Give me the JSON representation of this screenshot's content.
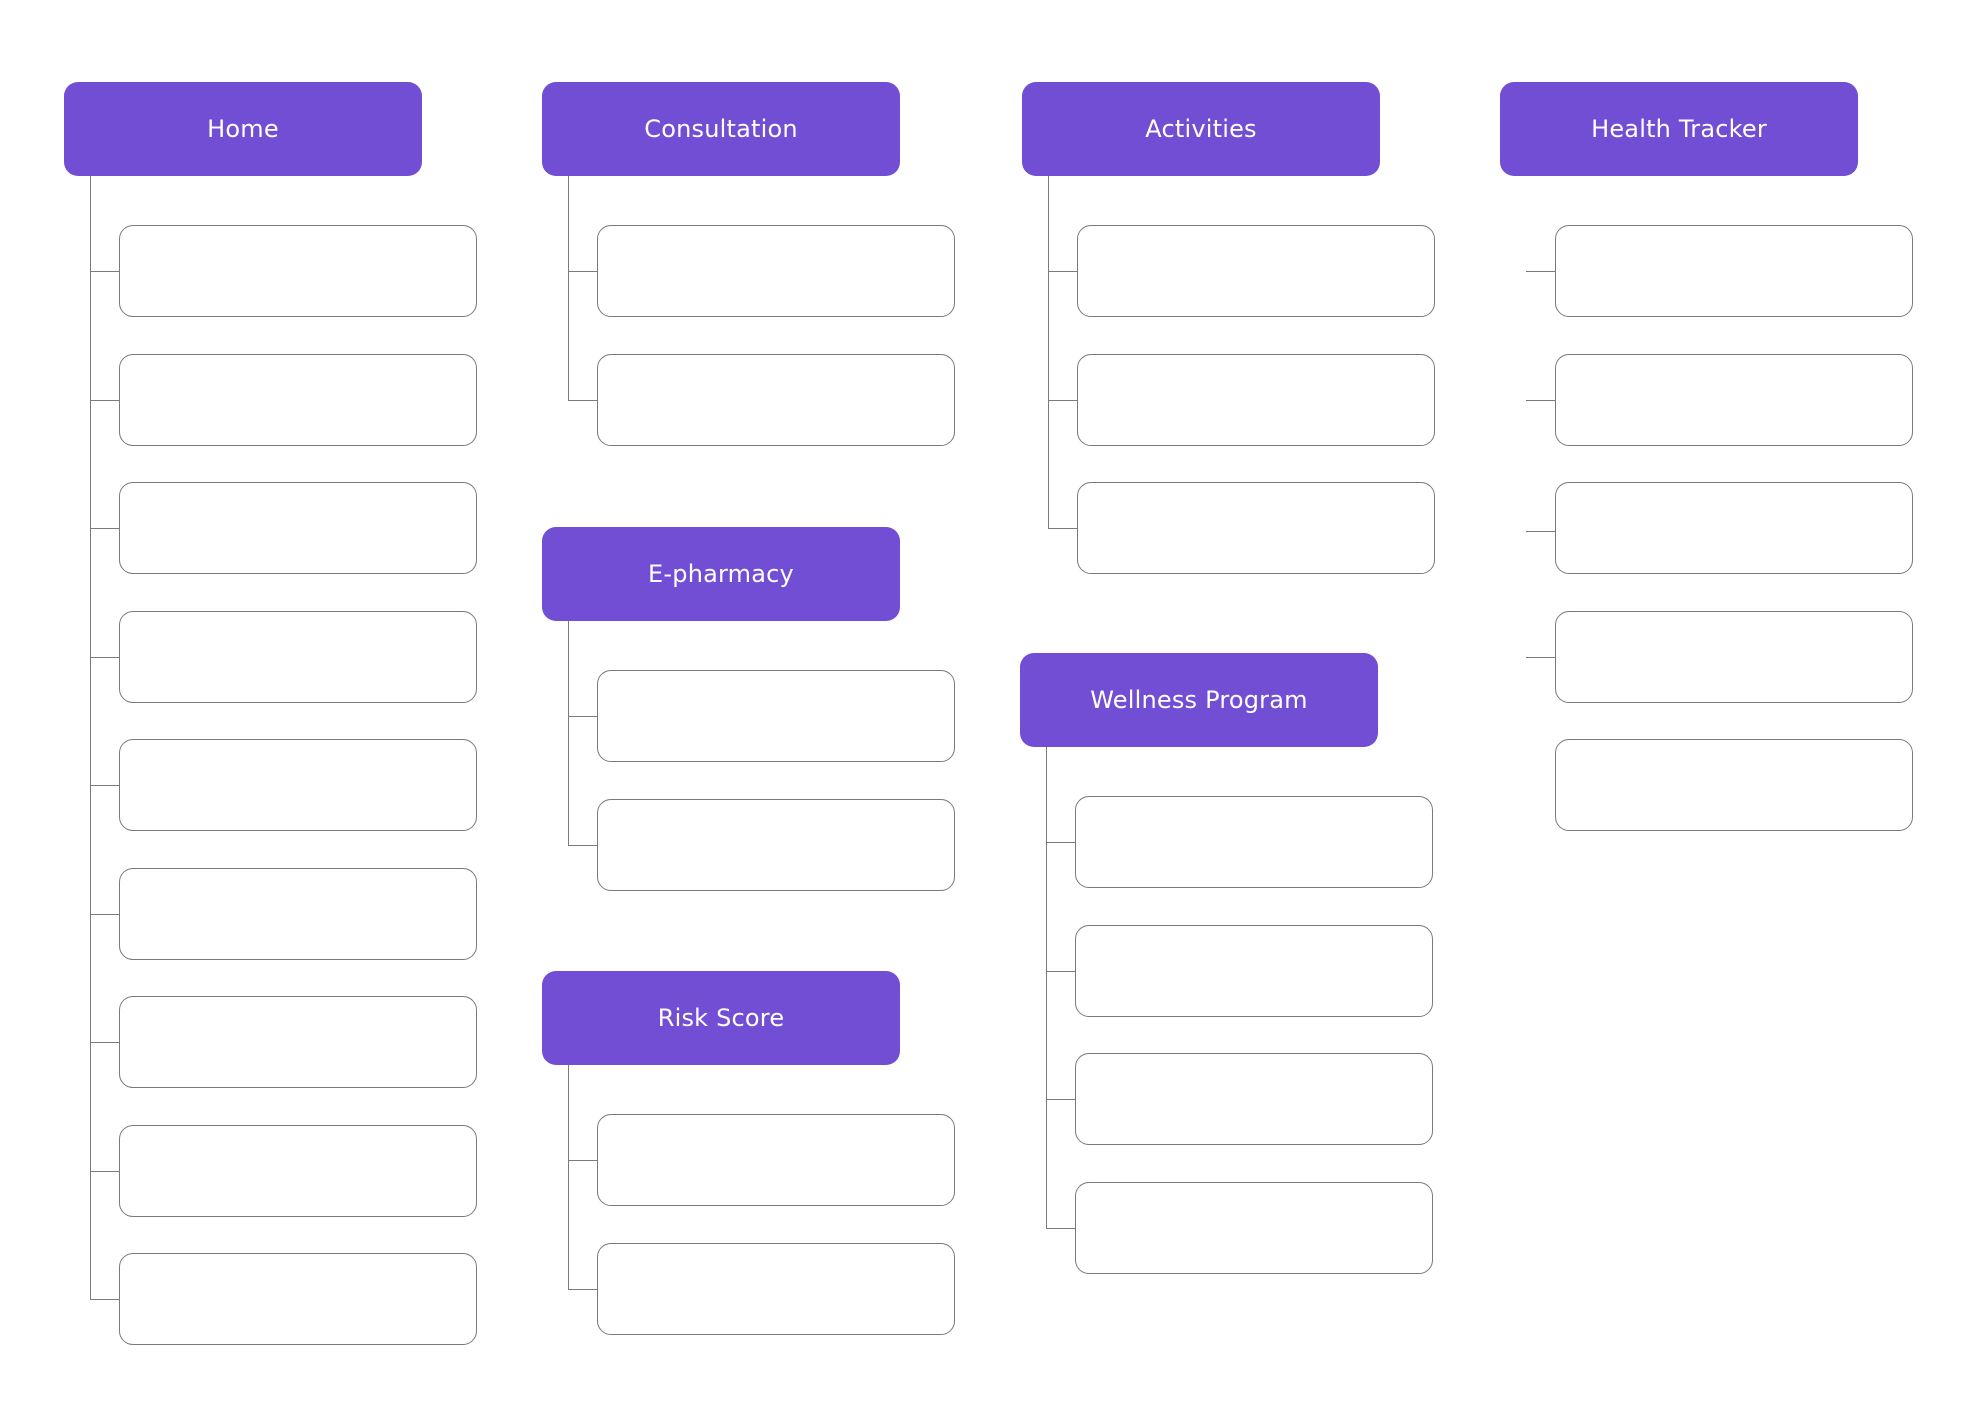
{
  "colors": {
    "header_fill": "#714ED4",
    "header_text": "#FFFFFF",
    "node_border": "#7A7A7A",
    "connector": "#7A7A7A",
    "background": "#FFFFFF"
  },
  "sections": [
    {
      "id": "home",
      "title": "Home",
      "child_count": 9,
      "connected": true
    },
    {
      "id": "consultation",
      "title": "Consultation",
      "child_count": 2,
      "connected": true
    },
    {
      "id": "e-pharmacy",
      "title": "E-pharmacy",
      "child_count": 2,
      "connected": true
    },
    {
      "id": "risk-score",
      "title": "Risk Score",
      "child_count": 2,
      "connected": true
    },
    {
      "id": "activities",
      "title": "Activities",
      "child_count": 3,
      "connected": true
    },
    {
      "id": "wellness-program",
      "title": "Wellness Program",
      "child_count": 4,
      "connected": true
    },
    {
      "id": "health-tracker",
      "title": "Health Tracker",
      "child_count": 5,
      "connected": false,
      "stub_count": 4
    }
  ]
}
